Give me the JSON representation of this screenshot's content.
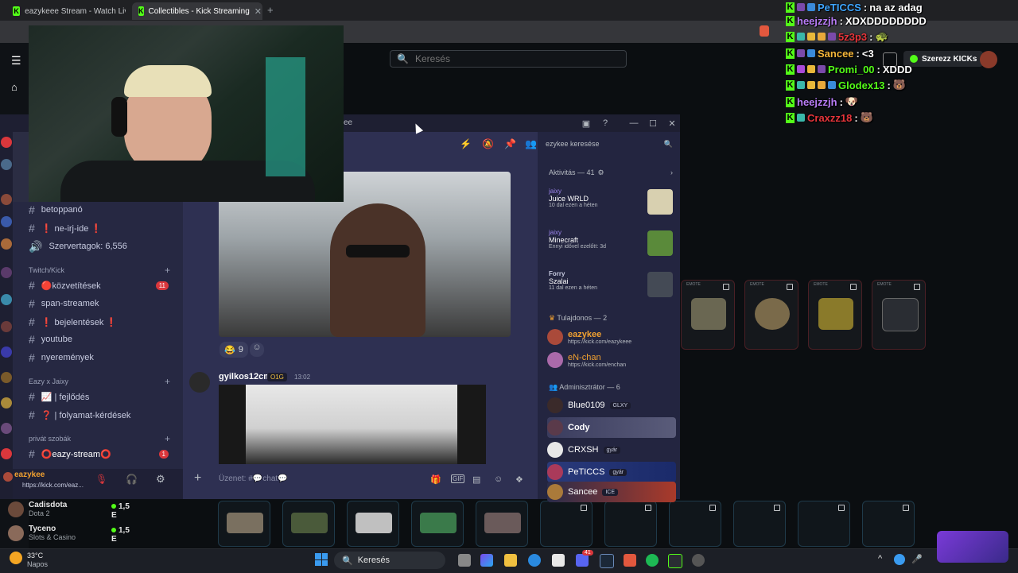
{
  "browser": {
    "tabs": [
      {
        "title": "eazykeee Stream - Watch Live on Kic",
        "active": false
      },
      {
        "title": "Collectibles - Kick Streaming",
        "active": true
      }
    ]
  },
  "kick": {
    "search_placeholder": "Keresés",
    "get_kicks_label": "Szerezz KICKs",
    "emote_label": "EMOTE",
    "following": [
      {
        "name": "Cadisdota",
        "category": "Dota 2",
        "viewers": "1,5 E"
      },
      {
        "name": "Tyceno",
        "category": "Slots & Casino",
        "viewers": "1,5 E"
      }
    ]
  },
  "discord": {
    "title_fragment": "ee",
    "search_placeholder": "ezykee keresése",
    "channels": [
      {
        "name": "betoppanó",
        "type": "text"
      },
      {
        "name": "❗ ne-irj-ide ❗",
        "type": "text"
      },
      {
        "name": "Szervertagok: 6,556",
        "type": "stat"
      }
    ],
    "category_twitch": "Twitch/Kick",
    "twitch_channels": [
      {
        "name": "🔴közvetítések",
        "badge": "11"
      },
      {
        "name": "span-streamek",
        "badge": ""
      },
      {
        "name": "❗ bejelentések ❗",
        "badge": ""
      },
      {
        "name": "youtube",
        "badge": ""
      },
      {
        "name": "nyeremények",
        "badge": ""
      }
    ],
    "category_eazy": "Eazy x Jaixy",
    "eazy_channels": [
      {
        "name": "📈 | fejlődés"
      },
      {
        "name": "❓ | folyamat-kérdések"
      }
    ],
    "category_private": "privát szobák",
    "private_channels": [
      {
        "name": "⭕eazy-stream⭕",
        "badge": "1"
      }
    ],
    "user": {
      "name": "eazykee",
      "status": "https://kick.com/eaz..."
    },
    "reactions": [
      {
        "emoji": "😂",
        "count": "9"
      }
    ],
    "message": {
      "author": "gyilkos12cm",
      "tag": "O1G",
      "time": "13:02"
    },
    "composer_placeholder": "Üzenet: #💬chat💬",
    "activity_header": "Aktivitás — 41",
    "activities": [
      {
        "user": "jaixy",
        "game": "Juice WRLD",
        "detail": "10 dal ezen a héten"
      },
      {
        "user": "jaixy",
        "game": "Minecraft",
        "detail": "Ennyi idővel ezelőtt: 3d"
      },
      {
        "user": "Forry",
        "game": "Szalai",
        "detail": "11 dal ezen a héten"
      }
    ],
    "owner_header": "Tulajdonos — 2",
    "owners": [
      {
        "name": "eazykee",
        "status": "https://kick.com/eazykeee",
        "color": "#f0a030"
      },
      {
        "name": "eN-chan",
        "status": "https://kick.com/enchan",
        "color": "#f0a030"
      }
    ],
    "admin_header": "Adminisztrátor — 6",
    "admins": [
      {
        "name": "Blue0109",
        "tag": "GLXY"
      },
      {
        "name": "Cody",
        "tag": ""
      },
      {
        "name": "CRXSH",
        "tag": "gyár"
      },
      {
        "name": "PeTICCS",
        "tag": "gyár"
      },
      {
        "name": "Sancee",
        "tag": "ICE"
      }
    ]
  },
  "chat_overlay": [
    {
      "user": "PeTICCS",
      "color": "#3ea6ff",
      "text": "na az adag"
    },
    {
      "user": "heejzzjh",
      "color": "#b87cf6",
      "text": "XDXDDDDDDDD"
    },
    {
      "user": "5z3p3",
      "color": "#e6353b",
      "text": "🐢"
    },
    {
      "user": "Sancee",
      "color": "#f5b63a",
      "text": "<3"
    },
    {
      "user": "Promi_00",
      "color": "#53fc18",
      "text": "XDDD"
    },
    {
      "user": "Glodex13",
      "color": "#53fc18",
      "text": "🐻"
    },
    {
      "user": "heejzzjh",
      "color": "#b87cf6",
      "text": "🐶"
    },
    {
      "user": "Craxzz18",
      "color": "#e6353b",
      "text": "🐻"
    }
  ],
  "taskbar": {
    "weather_temp": "33°C",
    "weather_text": "Napos",
    "search_label": "Keresés",
    "discord_badge": "41"
  },
  "colors": {
    "kick_green": "#53fc18",
    "discord_blurple": "#5865f2",
    "discord_bg": "#2b2d43"
  }
}
